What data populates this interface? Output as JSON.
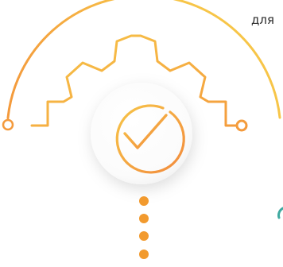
{
  "text_fragment": {
    "line_1": "",
    "line_2": "для"
  },
  "icons": {
    "center": "checkmark-circle-icon",
    "frame": "gear-outline-icon",
    "arc": "semicircle-arc-connector"
  },
  "colors": {
    "accent_yellow": "#F7C548",
    "accent_orange": "#F49A3C",
    "dot_orange": "#F29A2E",
    "teal_fragment": "#3fa9a0",
    "circle_fill": "#ffffff",
    "text": "#2a2a2a"
  }
}
